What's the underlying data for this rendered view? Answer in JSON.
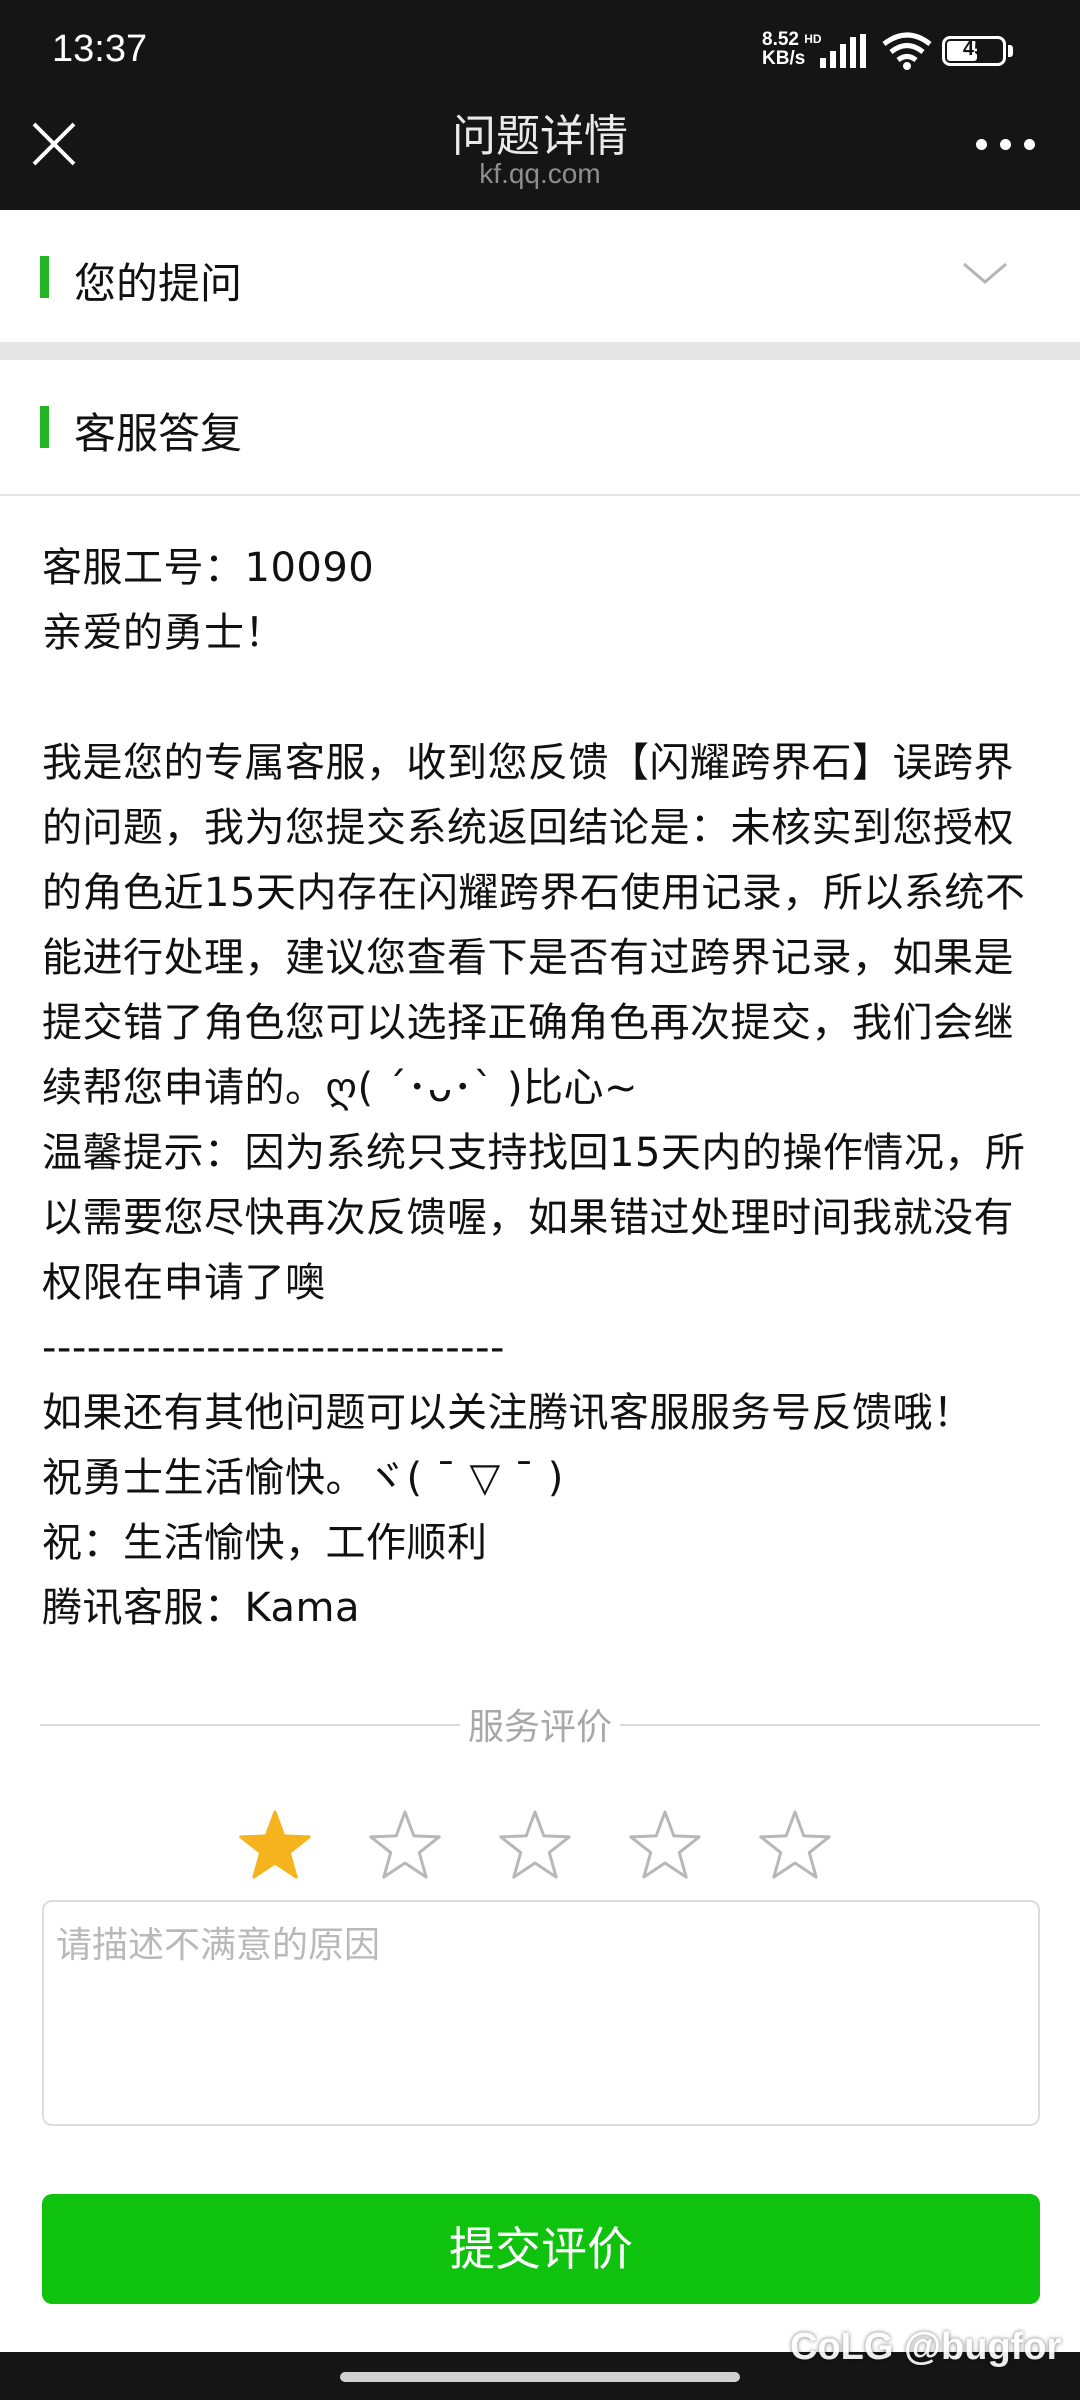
{
  "status_bar": {
    "time": "13:37",
    "net_speed": "8.52",
    "net_unit": "KB/s",
    "net_hd": "HD",
    "battery": "45"
  },
  "nav": {
    "title": "问题详情",
    "subtitle": "kf.qq.com"
  },
  "sections": {
    "question": "您的提问",
    "reply": "客服答复"
  },
  "reply_text": "客服工号：10090\n亲爱的勇士！\n\n我是您的专属客服，收到您反馈【闪耀跨界石】误跨界的问题，我为您提交系统返回结论是：未核实到您授权的角色近15天内存在闪耀跨界石使用记录，所以系统不能进行处理，建议您查看下是否有过跨界记录，如果是提交错了角色您可以选择正确角色再次提交，我们会继续帮您申请的。ღ( ´･ᴗ･` )比心~\n温馨提示：因为系统只支持找回15天内的操作情况，所以需要您尽快再次反馈喔，如果错过处理时间我就没有权限在申请了噢\n-------------------------------\n如果还有其他问题可以关注腾讯客服服务号反馈哦！\n祝勇士生活愉快。ヾ( ˉ ▽ ˉ )\n祝：生活愉快，工作顺利\n腾讯客服：Kama",
  "rating": {
    "label": "服务评价",
    "value": 1,
    "max": 5,
    "placeholder": "请描述不满意的原因",
    "submit": "提交评价",
    "star_filled_color": "#f5b31e",
    "star_empty_color": "#b8b8b8"
  },
  "colors": {
    "accent": "#22b422",
    "button": "#0ec20e",
    "bar_bg": "#151515"
  },
  "watermark": "CoLG @bugfor"
}
